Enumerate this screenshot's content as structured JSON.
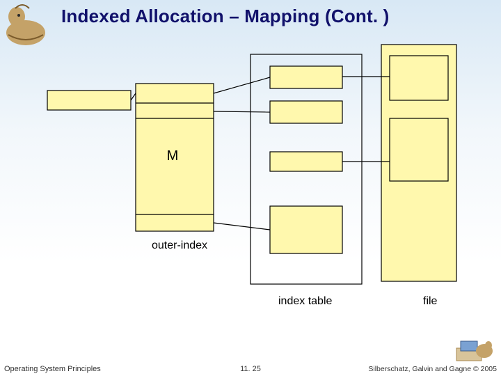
{
  "title": "Indexed Allocation – Mapping (Cont. )",
  "labels": {
    "outer_index": "outer-index",
    "index_table": "index table",
    "file": "file"
  },
  "glyphs": {
    "m_symbol": "M"
  },
  "footer": {
    "left": "Operating System Principles",
    "center": "11. 25",
    "right": "Silberschatz, Galvin and Gagne © 2005"
  }
}
